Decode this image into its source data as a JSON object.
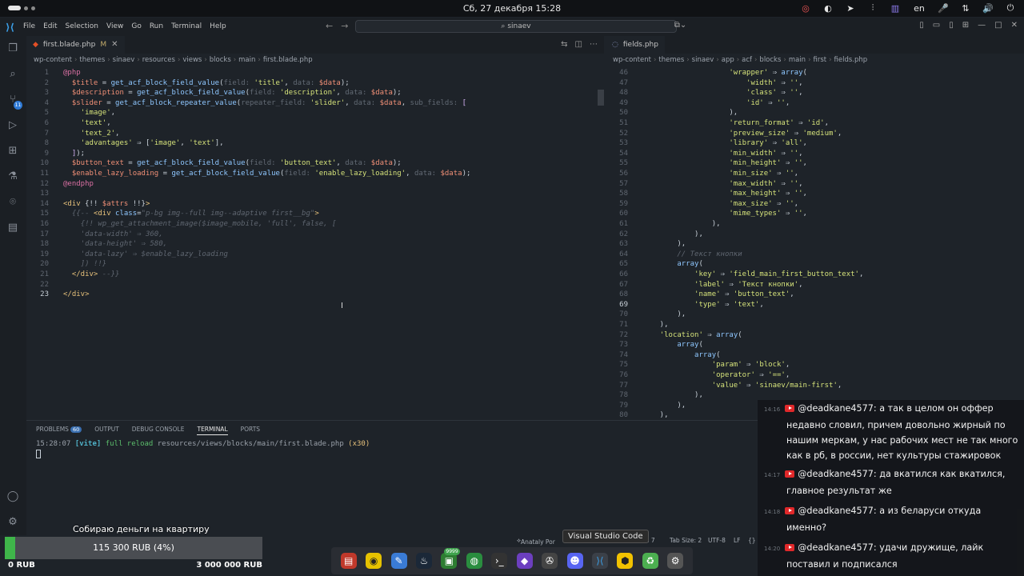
{
  "system": {
    "clock": "Сб, 27 декабря  15:28",
    "lang": "en"
  },
  "window": {
    "menu": [
      "File",
      "Edit",
      "Selection",
      "View",
      "Go",
      "Run",
      "Terminal",
      "Help"
    ],
    "search": "sinaev"
  },
  "left_editor": {
    "tab_name": "first.blade.php",
    "tab_modified": "M",
    "breadcrumb": [
      "wp-content",
      "themes",
      "sinaev",
      "resources",
      "views",
      "blocks",
      "main",
      "first.blade.php"
    ]
  },
  "right_editor": {
    "tab_name": "fields.php",
    "breadcrumb": [
      "wp-content",
      "themes",
      "sinaev",
      "app",
      "acf",
      "blocks",
      "main",
      "first",
      "fields.php"
    ]
  },
  "panel": {
    "tabs": [
      "PROBLEMS",
      "OUTPUT",
      "DEBUG CONSOLE",
      "TERMINAL",
      "PORTS"
    ],
    "active_tab": "TERMINAL",
    "problems_count": "60",
    "terminal_time": "15:28:07",
    "terminal_tag": "[vite]",
    "terminal_msg": "full reload",
    "terminal_path": "resources/views/blocks/main/first.blade.php",
    "terminal_count": "(x30)"
  },
  "status": {
    "author": "Anataly Por",
    "position": "3, Col 7",
    "tab_size": "Tab Size: 2",
    "encoding": "UTF-8",
    "eol": "LF",
    "tooltip": "Visual Studio Code"
  },
  "donation": {
    "title": "Собираю деньги на квартиру",
    "amount_label": "115 300 RUB (4%)",
    "progress": 0.04,
    "min_label": "0 RUB",
    "max_label": "3 000 000 RUB",
    "bar_color": "#3fb54a"
  },
  "dock": {
    "badge": "9999",
    "apps": [
      "files-icon",
      "rhythmbox-icon",
      "text-editor-icon",
      "steam-icon",
      "terminal-badge-icon",
      "chrome-icon",
      "terminal-icon",
      "obsidian-icon",
      "fan-icon",
      "discord-icon",
      "vscode-icon",
      "bee-icon",
      "trash-icon",
      "settings-icon"
    ]
  },
  "chat": [
    {
      "time": "14:16",
      "user": "@deadkane4577:",
      "text": "а так в целом он оффер недавно словил, причем довольно жирный по нашим меркам, у нас рабочих мест не так много как в рб, в россии, нет культуры стажировок"
    },
    {
      "time": "14:17",
      "user": "@deadkane4577:",
      "text": "да вкатился как вкатился, главное результат же"
    },
    {
      "time": "14:18",
      "user": "@deadkane4577:",
      "text": "а из беларуси откуда именно?"
    },
    {
      "time": "14:20",
      "user": "@deadkane4577:",
      "text": "удачи дружище, лайк поставил и подписался"
    }
  ],
  "code_left": [
    {
      "n": "1",
      "html": "<span class='kw'>@php</span>"
    },
    {
      "n": "2",
      "html": "  <span class='var'>$title</span> = <span class='fn'>get_acf_block_field_value</span>(<span class='hint'>field: </span><span class='str'>'title'</span>, <span class='hint'>data: </span><span class='var'>$data</span>);"
    },
    {
      "n": "3",
      "html": "  <span class='var'>$description</span> = <span class='fn'>get_acf_block_field_value</span>(<span class='hint'>field: </span><span class='str'>'description'</span>, <span class='hint'>data: </span><span class='var'>$data</span>);"
    },
    {
      "n": "4",
      "html": "  <span class='var'>$slider</span> = <span class='fn'>get_acf_block_repeater_value</span>(<span class='hint'>repeater_field: </span><span class='str'>'slider'</span>, <span class='hint'>data: </span><span class='var'>$data</span>, <span class='hint'>sub_fields: </span><span class='blk'>[</span>"
    },
    {
      "n": "5",
      "html": "    <span class='str'>'image'</span>,"
    },
    {
      "n": "6",
      "html": "    <span class='str'>'text'</span>,"
    },
    {
      "n": "7",
      "html": "    <span class='str'>'text_2'</span>,"
    },
    {
      "n": "8",
      "html": "    <span class='str'>'advantages'</span> ⇒ [<span class='str'>'image'</span>, <span class='str'>'text'</span>],"
    },
    {
      "n": "9",
      "html": "  <span class='blk'>]</span>);"
    },
    {
      "n": "10",
      "html": "  <span class='var'>$button_text</span> = <span class='fn'>get_acf_block_field_value</span>(<span class='hint'>field: </span><span class='str'>'button_text'</span>, <span class='hint'>data: </span><span class='var'>$data</span>);"
    },
    {
      "n": "11",
      "html": "  <span class='var'>$enable_lazy_loading</span> = <span class='fn'>get_acf_block_field_value</span>(<span class='hint'>field: </span><span class='str'>'enable_lazy_loading'</span>, <span class='hint'>data: </span><span class='var'>$data</span>);"
    },
    {
      "n": "12",
      "html": "<span class='kw'>@endphp</span>"
    },
    {
      "n": "13",
      "html": ""
    },
    {
      "n": "14",
      "html": "<span class='tag'>&lt;div</span> {!! <span class='var'>$attrs</span> !!}<span class='tag'>&gt;</span>"
    },
    {
      "n": "15",
      "html": "  <span class='cmt'>{{-- </span><span class='tag'>&lt;div</span> <span class='fn'>class</span>=<span class='cmt'>\"p-bg img--full img--adaptive first__bg\"</span><span class='tag'>&gt;</span>"
    },
    {
      "n": "16",
      "html": "    <span class='cmt'>{!! wp_get_attachment_image($image_mobile, 'full', false, [</span>"
    },
    {
      "n": "17",
      "html": "    <span class='cmt'>'data-width' ⇒ 360,</span>"
    },
    {
      "n": "18",
      "html": "    <span class='cmt'>'data-height' ⇒ 580,</span>"
    },
    {
      "n": "19",
      "html": "    <span class='cmt'>'data-lazy' ⇒ $enable_lazy_loading</span>"
    },
    {
      "n": "20",
      "html": "    <span class='cmt'>]) !!}</span>"
    },
    {
      "n": "21",
      "html": "  <span class='tag'>&lt;/div&gt;</span> <span class='cmt'>--}}</span>"
    },
    {
      "n": "22",
      "html": ""
    },
    {
      "n": "23",
      "html": "<span class='tag'>&lt;/div&gt;</span>"
    }
  ],
  "code_right": [
    {
      "n": "46",
      "html": "                    <span class='str'>'wrapper'</span> ⇒ <span class='fn'>array</span>("
    },
    {
      "n": "47",
      "html": "                        <span class='str'>'width'</span> ⇒ <span class='str'>''</span>,"
    },
    {
      "n": "48",
      "html": "                        <span class='str'>'class'</span> ⇒ <span class='str'>''</span>,"
    },
    {
      "n": "49",
      "html": "                        <span class='str'>'id'</span> ⇒ <span class='str'>''</span>,"
    },
    {
      "n": "50",
      "html": "                    ),"
    },
    {
      "n": "51",
      "html": "                    <span class='str'>'return_format'</span> ⇒ <span class='str'>'id'</span>,"
    },
    {
      "n": "52",
      "html": "                    <span class='str'>'preview_size'</span> ⇒ <span class='str'>'medium'</span>,"
    },
    {
      "n": "53",
      "html": "                    <span class='str'>'library'</span> ⇒ <span class='str'>'all'</span>,"
    },
    {
      "n": "54",
      "html": "                    <span class='str'>'min_width'</span> ⇒ <span class='str'>''</span>,"
    },
    {
      "n": "55",
      "html": "                    <span class='str'>'min_height'</span> ⇒ <span class='str'>''</span>,"
    },
    {
      "n": "56",
      "html": "                    <span class='str'>'min_size'</span> ⇒ <span class='str'>''</span>,"
    },
    {
      "n": "57",
      "html": "                    <span class='str'>'max_width'</span> ⇒ <span class='str'>''</span>,"
    },
    {
      "n": "58",
      "html": "                    <span class='str'>'max_height'</span> ⇒ <span class='str'>''</span>,"
    },
    {
      "n": "59",
      "html": "                    <span class='str'>'max_size'</span> ⇒ <span class='str'>''</span>,"
    },
    {
      "n": "60",
      "html": "                    <span class='str'>'mime_types'</span> ⇒ <span class='str'>''</span>,"
    },
    {
      "n": "61",
      "html": "                ),"
    },
    {
      "n": "62",
      "html": "            ),"
    },
    {
      "n": "63",
      "html": "        ),"
    },
    {
      "n": "64",
      "html": "        <span class='cmt'>// Текст кнопки</span>"
    },
    {
      "n": "65",
      "html": "        <span class='fn'>array</span>("
    },
    {
      "n": "66",
      "html": "            <span class='str'>'key'</span> ⇒ <span class='str'>'field_main_first_button_text'</span>,"
    },
    {
      "n": "67",
      "html": "            <span class='str'>'label'</span> ⇒ <span class='str'>'Текст кнопки'</span>,"
    },
    {
      "n": "68",
      "html": "            <span class='str'>'name'</span> ⇒ <span class='str'>'button_text'</span>,"
    },
    {
      "n": "69",
      "html": "            <span class='str'>'type'</span> ⇒ <span class='str'>'text'</span>,"
    },
    {
      "n": "70",
      "html": "        ),"
    },
    {
      "n": "71",
      "html": "    ),"
    },
    {
      "n": "72",
      "html": "    <span class='str'>'location'</span> ⇒ <span class='fn'>array</span>("
    },
    {
      "n": "73",
      "html": "        <span class='fn'>array</span>("
    },
    {
      "n": "74",
      "html": "            <span class='fn'>array</span>("
    },
    {
      "n": "75",
      "html": "                <span class='str'>'param'</span> ⇒ <span class='str'>'block'</span>,"
    },
    {
      "n": "76",
      "html": "                <span class='str'>'operator'</span> ⇒ <span class='str'>'=='</span>,"
    },
    {
      "n": "77",
      "html": "                <span class='str'>'value'</span> ⇒ <span class='str'>'sinaev/main-first'</span>,"
    },
    {
      "n": "78",
      "html": "            ),"
    },
    {
      "n": "79",
      "html": "        ),"
    },
    {
      "n": "80",
      "html": "    ),"
    }
  ]
}
